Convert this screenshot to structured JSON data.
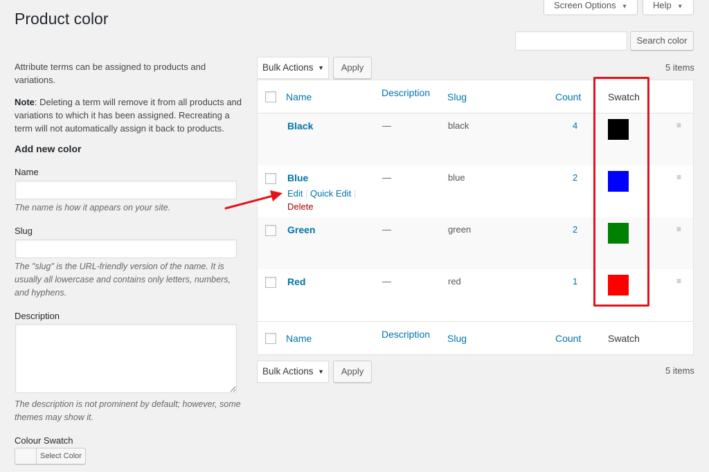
{
  "header": {
    "title": "Product color",
    "screen_options_label": "Screen Options",
    "help_label": "Help"
  },
  "search": {
    "placeholder": "",
    "button_label": "Search color"
  },
  "intro": {
    "text": "Attribute terms can be assigned to products and variations.",
    "note_label": "Note",
    "note_text": ": Deleting a term will remove it from all products and variations to which it has been assigned. Recreating a term will not automatically assign it back to products."
  },
  "form": {
    "title": "Add new color",
    "name_label": "Name",
    "name_value": "",
    "name_help": "The name is how it appears on your site.",
    "slug_label": "Slug",
    "slug_value": "",
    "slug_help": "The \"slug\" is the URL-friendly version of the name. It is usually all lowercase and contains only letters, numbers, and hyphens.",
    "description_label": "Description",
    "description_value": "",
    "description_help": "The description is not prominent by default; however, some themes may show it.",
    "swatch_label": "Colour Swatch",
    "select_color_label": "Select Color"
  },
  "bulk": {
    "selected": "Bulk Actions",
    "apply_label": "Apply",
    "items_count": "5 items"
  },
  "table": {
    "columns": {
      "name": "Name",
      "description": "Description",
      "slug": "Slug",
      "count": "Count",
      "swatch": "Swatch"
    },
    "rows": [
      {
        "name": "Black",
        "description": "—",
        "slug": "black",
        "count": "4",
        "swatch": "#000000"
      },
      {
        "name": "Blue",
        "description": "—",
        "slug": "blue",
        "count": "2",
        "swatch": "#0000ff"
      },
      {
        "name": "Green",
        "description": "—",
        "slug": "green",
        "count": "2",
        "swatch": "#008000"
      },
      {
        "name": "Red",
        "description": "—",
        "slug": "red",
        "count": "1",
        "swatch": "#ff0000"
      }
    ],
    "row_actions": {
      "edit": "Edit",
      "quick_edit": "Quick Edit",
      "delete": "Delete",
      "separator": "|"
    }
  },
  "annotation": {
    "highlight_color": "#e2141b",
    "arrow_color": "#e2141b"
  },
  "icons": {
    "dropdown": "caret-down-icon",
    "drag": "hamburger-icon",
    "drag_glyph": "≡"
  }
}
